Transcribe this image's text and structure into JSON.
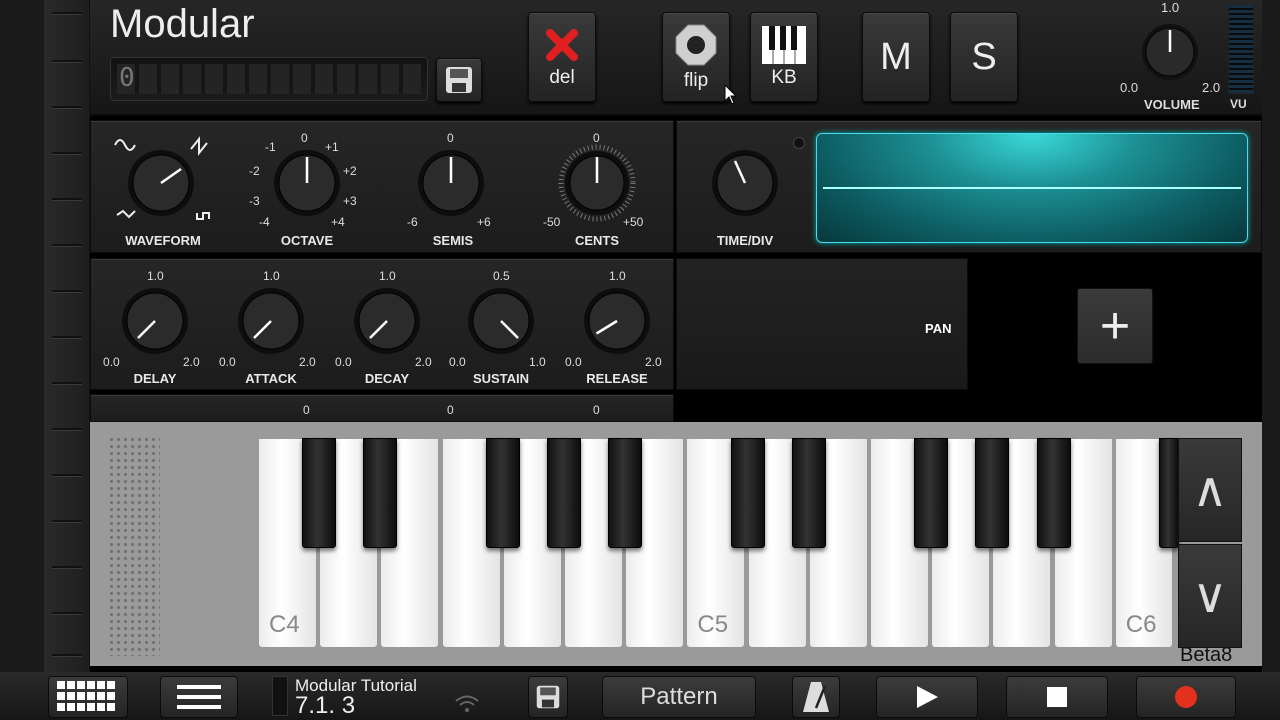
{
  "app": {
    "title": "Modular",
    "lcd_digit": "0"
  },
  "toolbar": {
    "del_label": "del",
    "flip_label": "flip",
    "kb_label": "KB",
    "mute_label": "M",
    "solo_label": "S"
  },
  "volume": {
    "label": "VOLUME",
    "min": "0.0",
    "max": "2.0",
    "top": "1.0",
    "vu_label": "VU"
  },
  "oscillator": {
    "waveform_label": "WAVEFORM",
    "octave": {
      "label": "OCTAVE",
      "ticks": [
        "-4",
        "-3",
        "-2",
        "-1",
        "0",
        "+1",
        "+2",
        "+3",
        "+4"
      ]
    },
    "semis": {
      "label": "SEMIS",
      "min": "-6",
      "mid": "0",
      "max": "+6"
    },
    "cents": {
      "label": "CENTS",
      "min": "-50",
      "mid": "0",
      "max": "+50"
    },
    "timediv_label": "TIME/DIV"
  },
  "envelope": [
    {
      "label": "DELAY",
      "min": "0.0",
      "max": "2.0",
      "top": "1.0",
      "value": 0.0
    },
    {
      "label": "ATTACK",
      "min": "0.0",
      "max": "2.0",
      "top": "1.0",
      "value": 0.0
    },
    {
      "label": "DECAY",
      "min": "0.0",
      "max": "2.0",
      "top": "1.0",
      "value": 0.0
    },
    {
      "label": "SUSTAIN",
      "min": "0.0",
      "max": "1.0",
      "top": "0.5",
      "value": 1.0
    },
    {
      "label": "RELEASE",
      "min": "0.0",
      "max": "2.0",
      "top": "1.0",
      "value": 0.1
    }
  ],
  "pan_label": "PAN",
  "add_label": "+",
  "keyboard": {
    "labels": [
      "C4",
      "C5",
      "C6"
    ],
    "up": "∧",
    "down": "∨",
    "beta": "Beta8"
  },
  "bottom": {
    "song_name": "Modular Tutorial",
    "song_position": "7.1. 3",
    "pattern_label": "Pattern"
  }
}
